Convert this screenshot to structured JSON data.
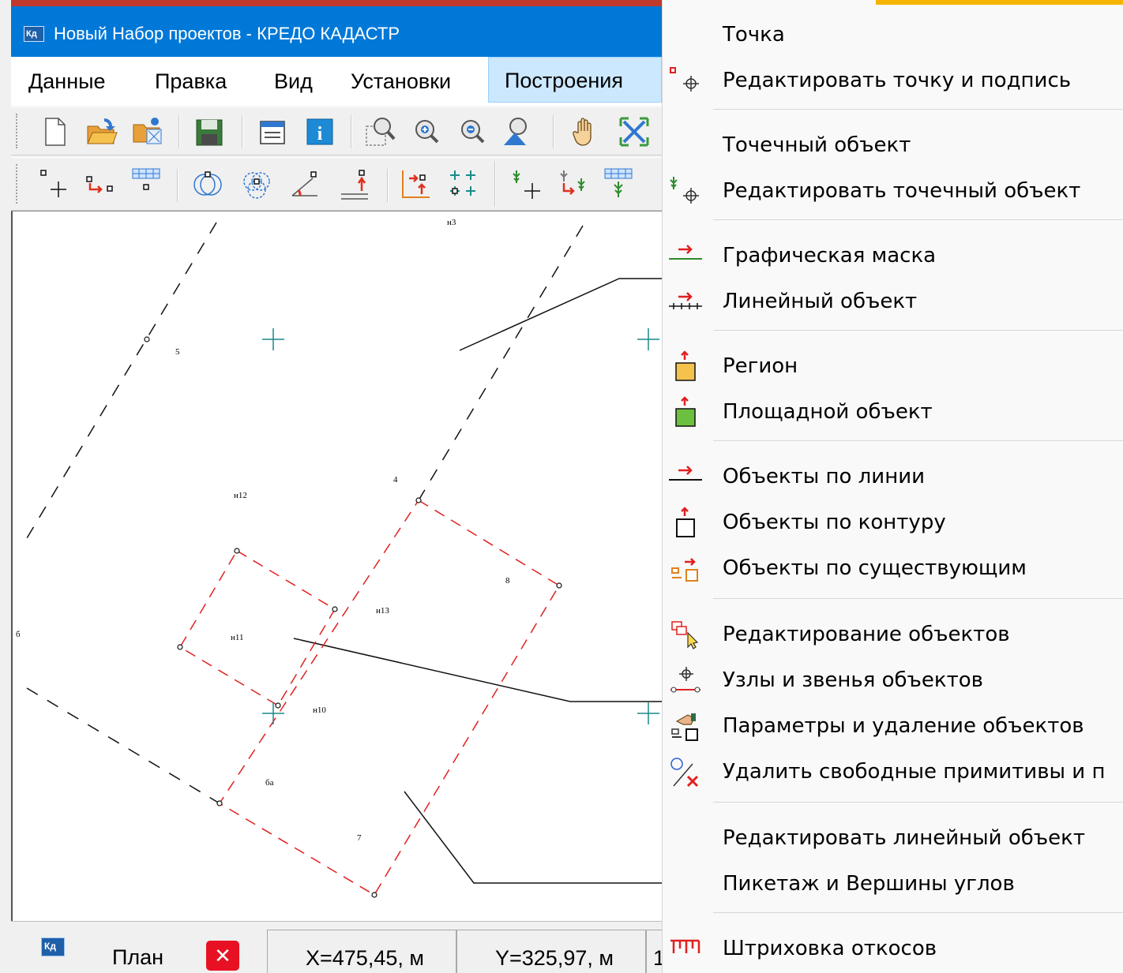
{
  "window": {
    "title": "Новый Набор проектов - КРЕДО КАДАСТР",
    "logo_text": "Кд"
  },
  "menu_bar": {
    "items": [
      {
        "label": "Данные"
      },
      {
        "label": "Правка"
      },
      {
        "label": "Вид"
      },
      {
        "label": "Установки"
      },
      {
        "label": "Построения",
        "active": true
      }
    ]
  },
  "toolbar_1": {
    "buttons": [
      "new-file-icon",
      "open-folder-icon",
      "open-project-icon",
      "save-icon",
      "properties-icon",
      "info-icon",
      "zoom-window-icon",
      "zoom-in-icon",
      "zoom-out-icon",
      "zoom-prev-icon",
      "pan-hand-icon",
      "zoom-extents-icon"
    ]
  },
  "toolbar_2": {
    "buttons": [
      "create-point-icon",
      "move-point-icon",
      "point-table-icon",
      "intersection-circles-icon",
      "intersection-dashed-icon",
      "angle-point-icon",
      "perpendicular-point-icon",
      "coord-transform-icon",
      "point-grid-icon",
      "tree-point-icon",
      "tree-move-icon",
      "tree-table-icon"
    ]
  },
  "drawing": {
    "labels": [
      {
        "text": "н3"
      },
      {
        "text": "5"
      },
      {
        "text": "4"
      },
      {
        "text": "н12"
      },
      {
        "text": "8"
      },
      {
        "text": "н13"
      },
      {
        "text": "б"
      },
      {
        "text": "н11"
      },
      {
        "text": "н10"
      },
      {
        "text": "ба"
      },
      {
        "text": "7"
      }
    ]
  },
  "status_bar": {
    "logo_text": "Кд",
    "plan_tab": "План",
    "close_symbol": "✕",
    "coord_x": "X=475,45, м",
    "coord_y": "Y=325,97, м",
    "scale": "1"
  },
  "dropdown": {
    "items": [
      {
        "label": "Точка",
        "icon": "none"
      },
      {
        "label": "Редактировать точку и подпись",
        "icon": "edit-point-icon"
      },
      {
        "label": "Точечный объект",
        "icon": "none"
      },
      {
        "label": "Редактировать точечный объект",
        "icon": "edit-point-object-icon"
      },
      {
        "label": "Графическая маска",
        "icon": "graphic-mask-icon"
      },
      {
        "label": "Линейный объект",
        "icon": "linear-object-icon"
      },
      {
        "label": "Регион",
        "icon": "region-icon"
      },
      {
        "label": "Площадной объект",
        "icon": "area-object-icon"
      },
      {
        "label": "Объекты по линии",
        "icon": "objects-by-line-icon"
      },
      {
        "label": "Объекты по контуру",
        "icon": "objects-by-contour-icon"
      },
      {
        "label": "Объекты по существующим",
        "icon": "objects-by-existing-icon"
      },
      {
        "label": "Редактирование объектов",
        "icon": "edit-objects-icon"
      },
      {
        "label": "Узлы и звенья объектов",
        "icon": "nodes-links-icon"
      },
      {
        "label": "Параметры и удаление объектов",
        "icon": "params-delete-icon"
      },
      {
        "label": "Удалить свободные примитивы и п",
        "icon": "delete-primitives-icon"
      },
      {
        "label": "Редактировать линейный объект",
        "icon": "none"
      },
      {
        "label": "Пикетаж и Вершины углов",
        "icon": "none"
      },
      {
        "label": "Штриховка откосов",
        "icon": "slope-hatching-icon"
      }
    ]
  },
  "colors": {
    "title_bar": "#0078d7",
    "menu_active": "#cce8ff",
    "contour_red": "#e02020",
    "cross_teal": "#1a8a8a",
    "close_red": "#e81123",
    "accent_orange": "#f5b400"
  }
}
